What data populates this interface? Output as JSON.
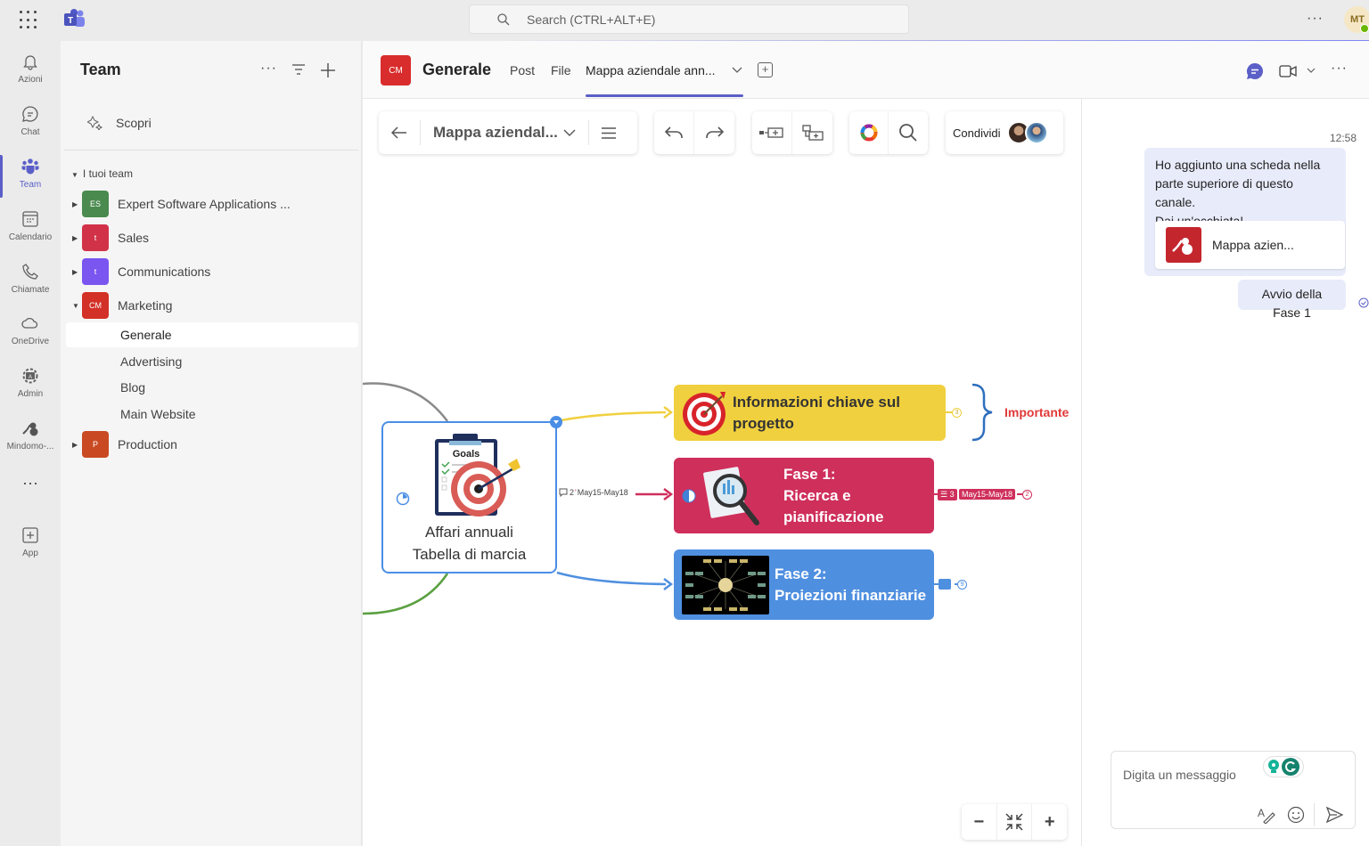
{
  "topbar": {
    "search_placeholder": "Search (CTRL+ALT+E)",
    "more_label": "···",
    "user_initials": "MT",
    "user_status": "available"
  },
  "rail": {
    "items": [
      {
        "label": "Azioni",
        "icon": "bell-icon"
      },
      {
        "label": "Chat",
        "icon": "chat-icon"
      },
      {
        "label": "Team",
        "icon": "teams-icon",
        "active": true
      },
      {
        "label": "Calendario",
        "icon": "calendar-icon"
      },
      {
        "label": "Chiamate",
        "icon": "phone-icon"
      },
      {
        "label": "OneDrive",
        "icon": "cloud-icon"
      },
      {
        "label": "Admin",
        "icon": "admin-gear-icon"
      },
      {
        "label": "Mindomo-...",
        "icon": "mindomo-icon"
      },
      {
        "label": "···",
        "icon": "more-icon"
      },
      {
        "label": "App",
        "icon": "add-app-icon"
      }
    ]
  },
  "sidebar": {
    "title": "Team",
    "discover_label": "Scopri",
    "group_label": "I tuoi team",
    "teams": [
      {
        "initials": "ES",
        "name": "Expert Software Applications ...",
        "color": "#4a8a4f",
        "expanded": false
      },
      {
        "initials": "t",
        "name": "Sales",
        "color": "#d13248",
        "expanded": false
      },
      {
        "initials": "t",
        "name": "Communications",
        "color": "#7a55f0",
        "expanded": false
      },
      {
        "initials": "CM",
        "name": "Marketing",
        "color": "#d33027",
        "expanded": true
      },
      {
        "initials": "P",
        "name": "Production",
        "color": "#c94a22",
        "expanded": false
      }
    ],
    "channels": [
      "Generale",
      "Advertising",
      "Blog",
      "Main Website"
    ],
    "active_channel": "Generale"
  },
  "channel": {
    "badge": "CM",
    "title": "Generale",
    "tabs": [
      "Post",
      "File",
      "Mappa aziendale ann..."
    ],
    "active_tab": "Mappa aziendale ann..."
  },
  "mindmap": {
    "toolbar": {
      "map_title": "Mappa aziendal...",
      "share_label": "Condividi"
    },
    "central": {
      "image_label": "Goals",
      "line1": "Affari annuali",
      "line2": "Tabella di marcia",
      "comment_count": "2",
      "date_range": "May15-May18"
    },
    "topics": [
      {
        "line1": "Informazioni chiave sul",
        "line2": "progetto",
        "color": "#f0d03e",
        "text_color": "#333333",
        "child_count": "3",
        "boundary_label": "Importante"
      },
      {
        "line1": "Fase 1:",
        "line2": "Ricerca e",
        "line3": "pianificazione",
        "color": "#cf2f5b",
        "task_count": "3",
        "date_range": "May15-May18",
        "child_count": "2"
      },
      {
        "line1": "Fase 2:",
        "line2": "Proiezioni finanziarie",
        "color": "#4f8fe0",
        "child_count": "9"
      }
    ],
    "zoom_controls": {
      "minus": "−",
      "plus": "+"
    }
  },
  "chat": {
    "time": "12:58",
    "message1": [
      "Ho aggiunto una scheda nella",
      "parte superiore di questo canale.",
      "Dai un'occhiata!"
    ],
    "card_label": "Mappa azien...",
    "message2": "Avvio della Fase 1",
    "compose_placeholder": "Digita un messaggio"
  }
}
